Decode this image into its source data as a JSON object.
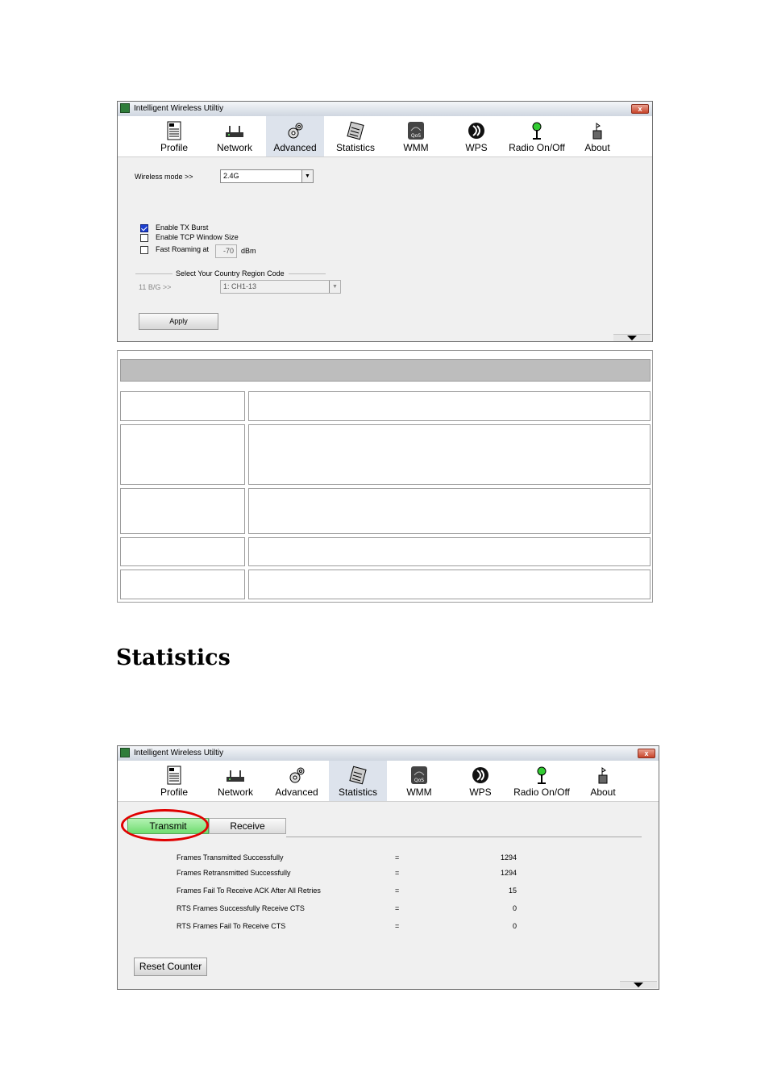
{
  "window1": {
    "title": "Intelligent Wireless Utiltiy",
    "close_label": "x",
    "toolbar": [
      {
        "label": "Profile",
        "icon": "profile-icon"
      },
      {
        "label": "Network",
        "icon": "network-icon"
      },
      {
        "label": "Advanced",
        "icon": "advanced-icon"
      },
      {
        "label": "Statistics",
        "icon": "statistics-icon"
      },
      {
        "label": "WMM",
        "icon": "wmm-icon"
      },
      {
        "label": "WPS",
        "icon": "wps-icon"
      },
      {
        "label": "Radio On/Off",
        "icon": "radio-icon"
      },
      {
        "label": "About",
        "icon": "about-icon"
      }
    ],
    "active_tab": "Advanced",
    "wireless_mode_label": "Wireless mode >>",
    "wireless_mode_value": "2.4G",
    "enable_tx_burst": "Enable TX Burst",
    "enable_tx_burst_checked": true,
    "enable_tcp_window": "Enable TCP Window Size",
    "enable_tcp_window_checked": false,
    "fast_roaming": "Fast Roaming at",
    "fast_roaming_checked": false,
    "fast_roaming_value": "-70",
    "fast_roaming_unit": "dBm",
    "country_region_title": "Select Your Country Region Code",
    "region_label": "11 B/G >>",
    "region_value": "1: CH1-13",
    "apply_label": "Apply"
  },
  "section_title": "Statistics",
  "window2": {
    "title": "Intelligent Wireless Utiltiy",
    "close_label": "x",
    "active_tab": "Statistics",
    "transmit_tab": "Transmit",
    "receive_tab": "Receive",
    "stats": [
      {
        "label": "Frames Transmitted Successfully",
        "eq": "=",
        "value": "1294"
      },
      {
        "label": "Frames Retransmitted Successfully",
        "eq": "=",
        "value": "1294"
      },
      {
        "label": "Frames Fail To Receive ACK After All Retries",
        "eq": "=",
        "value": "15"
      },
      {
        "label": "RTS Frames Successfully Receive CTS",
        "eq": "=",
        "value": "0"
      },
      {
        "label": "RTS Frames Fail To Receive CTS",
        "eq": "=",
        "value": "0"
      }
    ],
    "reset_label": "Reset Counter"
  },
  "colors": {
    "transmit_tab": "#7fe07f",
    "highlight_ring": "#e00000",
    "active_toolbar": "#dde3ec",
    "table_header": "#bdbdbd"
  }
}
